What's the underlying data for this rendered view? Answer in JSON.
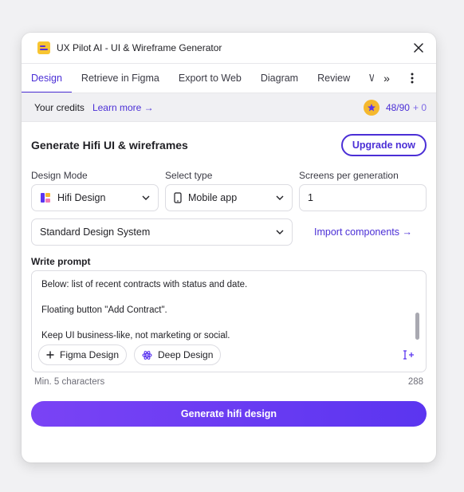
{
  "window": {
    "title": "UX Pilot AI - UI & Wireframe Generator"
  },
  "tabs": [
    {
      "label": "Design",
      "active": true
    },
    {
      "label": "Retrieve in Figma"
    },
    {
      "label": "Export to Web"
    },
    {
      "label": "Diagram"
    },
    {
      "label": "Review"
    },
    {
      "label": "Works"
    }
  ],
  "tabs_more_label": "»",
  "credits": {
    "label": "Your credits",
    "learn_more": "Learn more →",
    "used": "48",
    "total": "/90",
    "bonus": "+ 0"
  },
  "section": {
    "title": "Generate Hifi UI & wireframes",
    "upgrade": "Upgrade now"
  },
  "design_mode": {
    "label": "Design Mode",
    "value": "Hifi Design"
  },
  "select_type": {
    "label": "Select type",
    "value": "Mobile app"
  },
  "screens": {
    "label": "Screens per generation",
    "value": "1"
  },
  "design_system": {
    "value": "Standard Design System"
  },
  "import_components": "Import components →",
  "prompt": {
    "label": "Write prompt",
    "lines": [
      "Below: list of recent contracts with status and date.",
      "Floating button \"Add Contract\".",
      "Keep UI business-like, not marketing or social."
    ],
    "chips": {
      "figma": "Figma Design",
      "deep": "Deep Design"
    }
  },
  "hint": "Min. 5 characters",
  "char_count": "288",
  "generate_button": "Generate hifi design",
  "colors": {
    "accent": "#4b2fd6",
    "gradient_start": "#7a43f5",
    "gradient_end": "#5b35f0",
    "credit_badge": "#f5b82e"
  }
}
